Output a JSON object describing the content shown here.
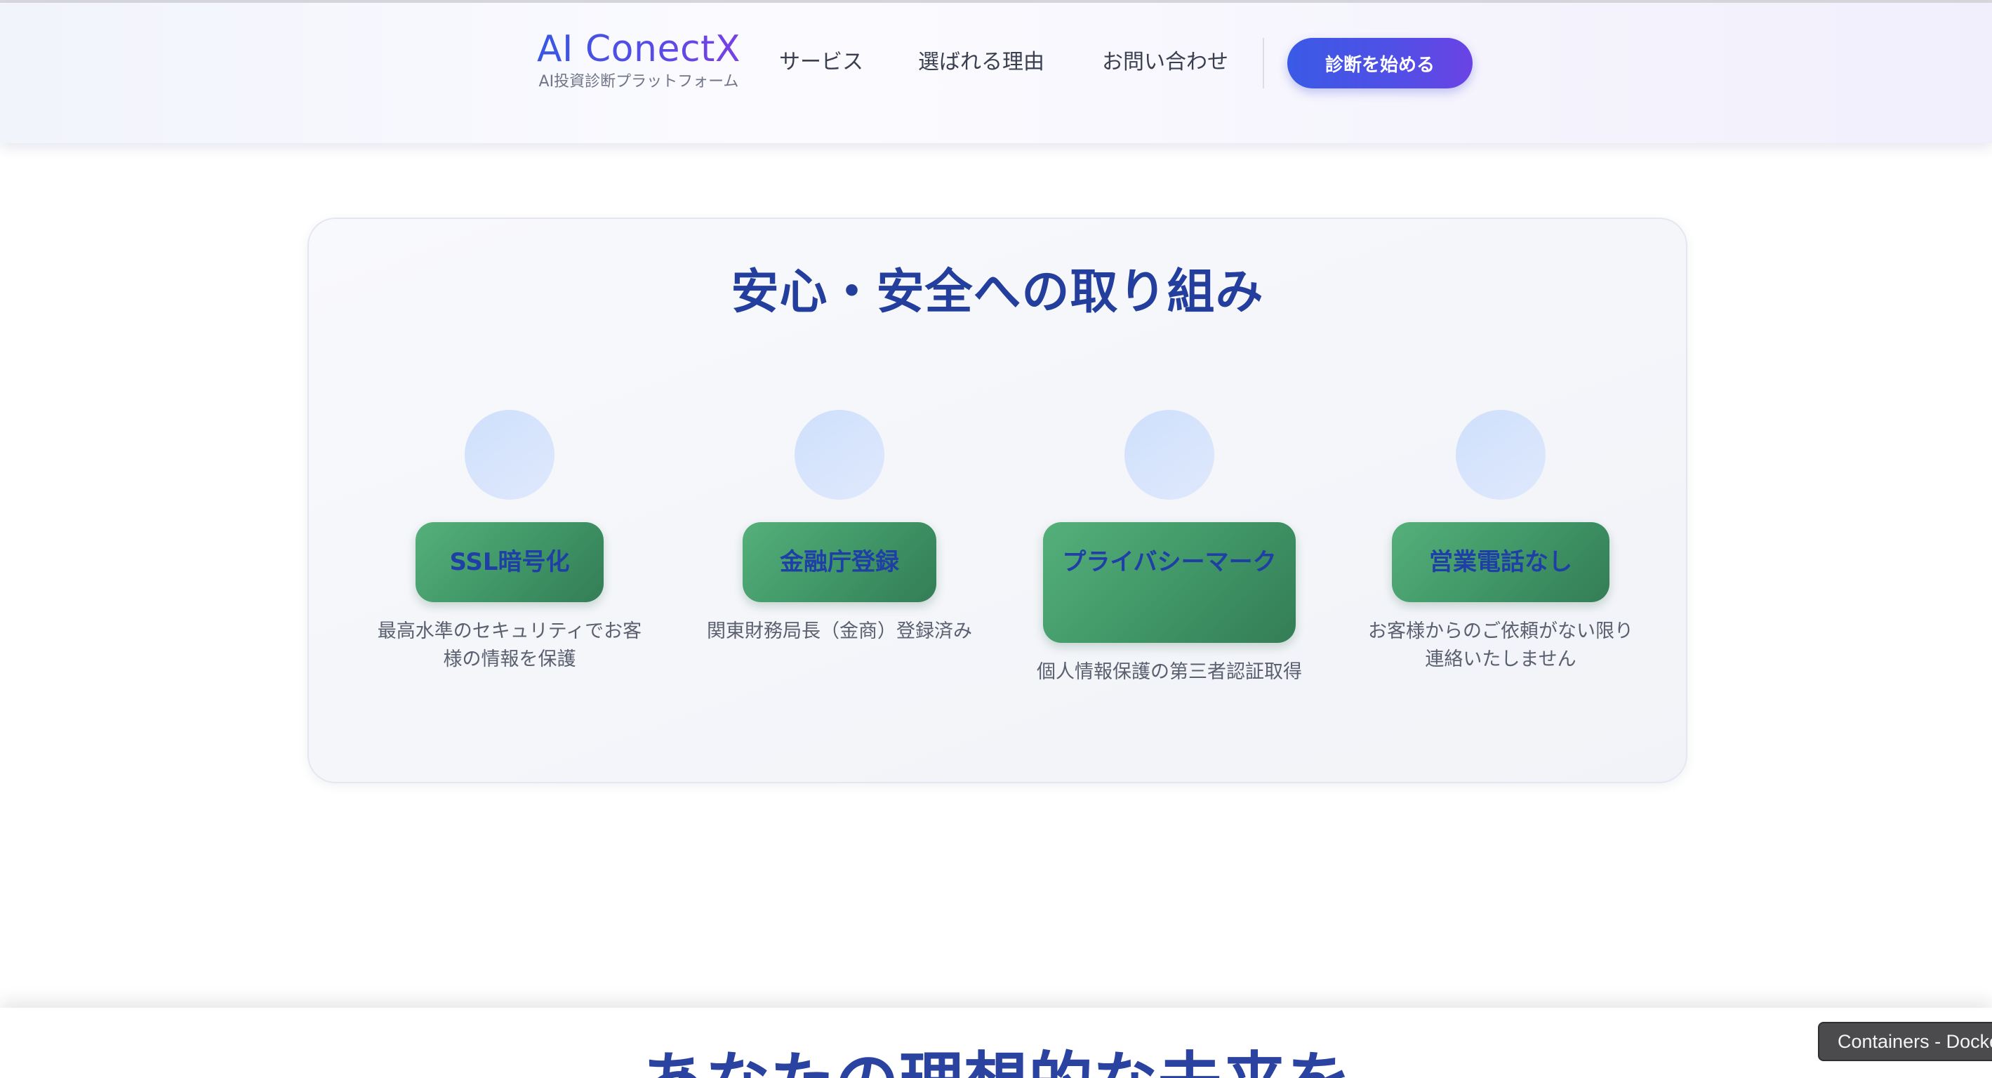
{
  "header": {
    "brand_title": "AI ConectX",
    "brand_subtitle": "AI投資診断プラットフォーム",
    "nav": [
      "サービス",
      "選ばれる理由",
      "お問い合わせ"
    ],
    "cta_label": "診断を始める"
  },
  "security": {
    "title": "安心・安全への取り組み",
    "features": [
      {
        "label": "SSL暗号化",
        "description": "最高水準のセキュリティでお客様の情報を保護"
      },
      {
        "label": "金融庁登録",
        "description": "関東財務局長（金商）登録済み"
      },
      {
        "label": "プライバシーマーク",
        "description": "個人情報保護の第三者認証取得"
      },
      {
        "label": "営業電話なし",
        "description": "お客様からのご依頼がない限り連絡いたしません"
      }
    ]
  },
  "next_section": {
    "title": "あなたの理想的な未来を"
  },
  "tooltip": {
    "text": "Containers - Docker"
  },
  "colors": {
    "brand_gradient_start": "#3757e3",
    "brand_gradient_end": "#7a3fe4",
    "heading_blue": "#233e9c",
    "badge_green": "#3f9566",
    "icon_circle": "#d6e3fc"
  }
}
